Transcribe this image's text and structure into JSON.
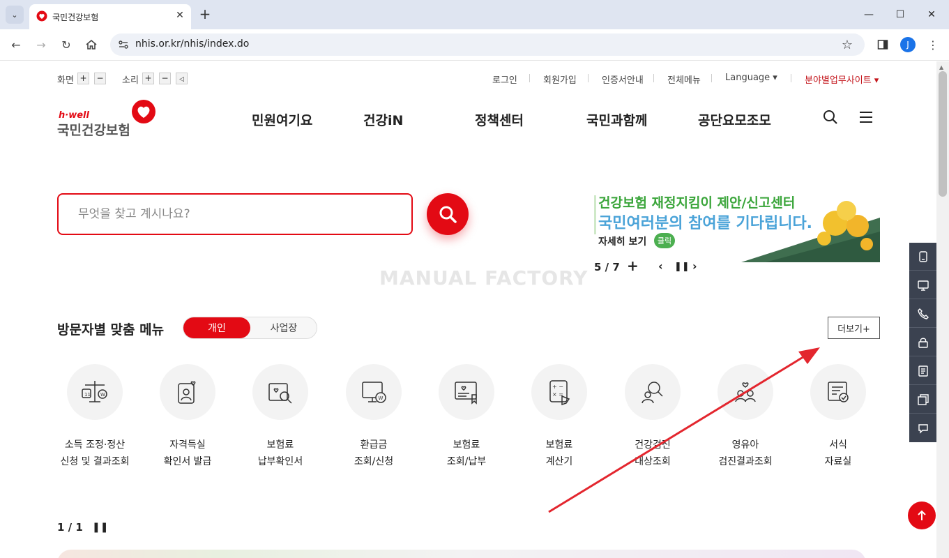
{
  "browser": {
    "tab_title": "국민건강보험",
    "url": "nhis.or.kr/nhis/index.do",
    "profile_initial": "J"
  },
  "utility": {
    "screen_label": "화면",
    "sound_label": "소리",
    "plus": "+",
    "minus": "−",
    "links": [
      "로그인",
      "회원가입",
      "인증서안내",
      "전체메뉴"
    ],
    "language": "Language ▾",
    "related_sites": "분야별업무사이트 ▾"
  },
  "logo": {
    "hwell": "h·well",
    "name": "국민건강보험"
  },
  "gnb": [
    "민원여기요",
    "건강iN",
    "정책센터",
    "국민과함께",
    "공단요모조모"
  ],
  "search": {
    "placeholder": "무엇을 찾고 계시나요?"
  },
  "banner": {
    "line1": "건강보험 재정지킴이 제안/신고센터",
    "line2": "국민여러분의 참여를 기다립니다.",
    "detail": "자세히 보기",
    "click": "클릭",
    "counter": "5 / 7"
  },
  "watermark": "MANUAL FACTORY",
  "section": {
    "title": "방문자별 맞춤 메뉴",
    "tab_personal": "개인",
    "tab_business": "사업장",
    "more": "더보기+"
  },
  "menu": [
    {
      "label": "소득 조정·정산\n신청 및 결과조회",
      "icon": "scale-icon"
    },
    {
      "label": "자격득실\n확인서 발급",
      "icon": "id-card-icon"
    },
    {
      "label": "보험료\n납부확인서",
      "icon": "document-search-icon"
    },
    {
      "label": "환급금\n조회/신청",
      "icon": "monitor-coin-icon"
    },
    {
      "label": "보험료\n조회/납부",
      "icon": "payment-icon"
    },
    {
      "label": "보험료\n계산기",
      "icon": "calculator-icon"
    },
    {
      "label": "건강검진\n대상조회",
      "icon": "people-search-icon"
    },
    {
      "label": "영유아\n검진결과조회",
      "icon": "family-icon"
    },
    {
      "label": "서식\n자료실",
      "icon": "form-icon"
    }
  ],
  "pager": "1 / 1",
  "colors": {
    "brand_red": "#e30a14",
    "quick_menu_bg": "#3b4250"
  }
}
